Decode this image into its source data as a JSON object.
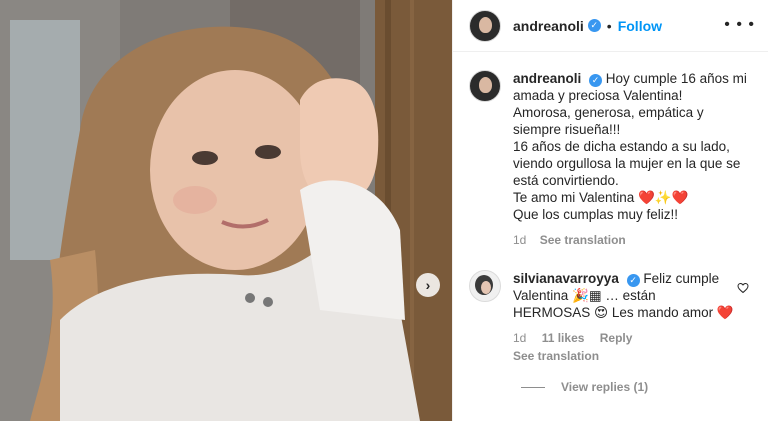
{
  "photo": {
    "next_icon": "chevron-right-icon"
  },
  "header": {
    "username": "andreanoli",
    "verified_icon": "verified-badge-icon",
    "separator": "•",
    "follow_label": "Follow",
    "more_icon": "more-options-icon"
  },
  "caption": {
    "username": "andreanoli",
    "text": "Hoy cumple 16 años mi amada y preciosa Valentina!\nAmorosa, generosa, empática y siempre risueña!!!\n16 años de dicha estando a su lado, viendo orgullosa la mujer en la que se está convirtiendo.\nTe amo mi Valentina ❤️✨❤️\nQue los cumplas muy feliz!!",
    "time": "1d",
    "translate_label": "See translation"
  },
  "comment": {
    "username": "silvianavarroyya",
    "text": "Feliz cumple Valentina 🎉▦ … están HERMOSAS 😍 Les mando amor ❤️",
    "time": "1d",
    "likes": "11 likes",
    "reply_label": "Reply",
    "translate_label": "See translation",
    "like_icon": "heart-icon"
  },
  "replies": {
    "label": "View replies (1)"
  },
  "colors": {
    "accent": "#0095f6",
    "verified": "#3897f0",
    "muted": "#8e8e8e",
    "text": "#262626"
  }
}
